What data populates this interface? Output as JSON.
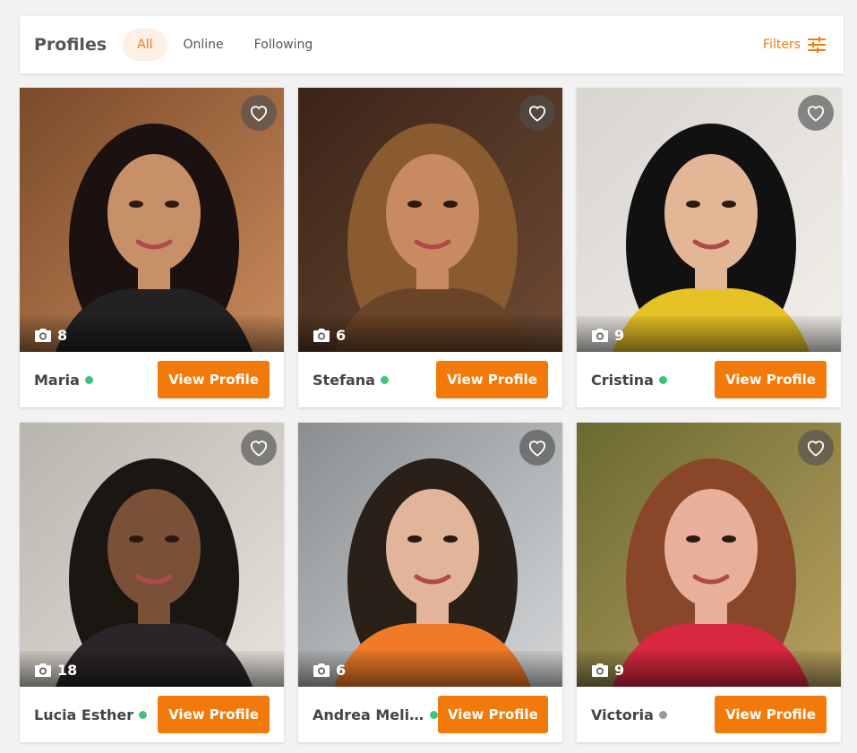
{
  "header": {
    "title": "Profiles",
    "tabs": [
      {
        "label": "All",
        "active": true
      },
      {
        "label": "Online",
        "active": false
      },
      {
        "label": "Following",
        "active": false
      }
    ],
    "filters_label": "Filters",
    "filters_icon": "sliders-icon"
  },
  "colors": {
    "accent": "#f27a0a",
    "online": "#3dc47e",
    "offline": "#9a9a9a"
  },
  "profiles": [
    {
      "name": "Maria",
      "photos": "8",
      "status": "online",
      "button": "View Profile"
    },
    {
      "name": "Stefana",
      "photos": "6",
      "status": "online",
      "button": "View Profile"
    },
    {
      "name": "Cristina",
      "photos": "9",
      "status": "online",
      "button": "View Profile"
    },
    {
      "name": "Lucia Esther",
      "photos": "18",
      "status": "online",
      "button": "View Profile"
    },
    {
      "name": "Andrea Meli...",
      "photos": "6",
      "status": "online",
      "button": "View Profile"
    },
    {
      "name": "Victoria",
      "photos": "9",
      "status": "offline",
      "button": "View Profile"
    }
  ]
}
